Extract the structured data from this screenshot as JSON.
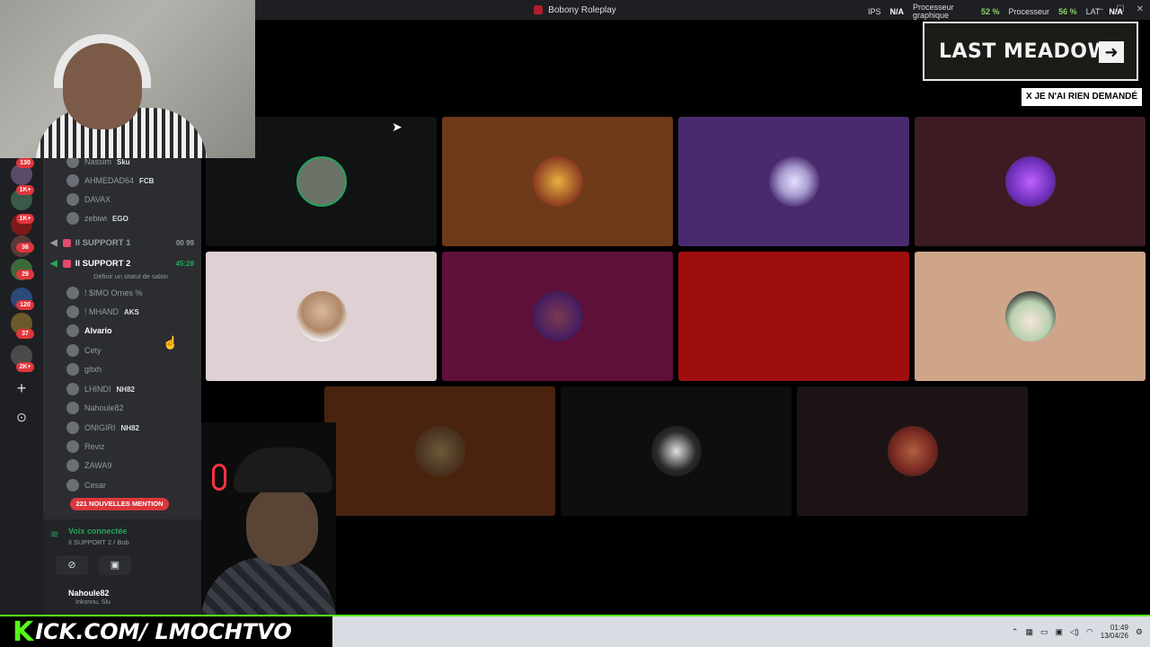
{
  "window": {
    "title": "Bobony Roleplay",
    "controls": [
      "–",
      "☐",
      "✕"
    ]
  },
  "stats": {
    "ips_label": "IPS",
    "ips_value": "N/A",
    "cpu_gpu_label": "Processeur graphique",
    "cpu_gpu_value": "52 %",
    "cpu_label": "Processeur",
    "cpu_value": "56 %",
    "lat_label": "LAT",
    "lat_value": "N/A"
  },
  "rail": {
    "badges": [
      "130",
      "1K+",
      "1K+",
      "36",
      "29",
      "120",
      "37",
      "2K+"
    ],
    "add_icon": "+",
    "explore_icon": "compass-icon"
  },
  "sidebar": {
    "top_members": [
      {
        "name": "Nassim",
        "tag": "Sku"
      },
      {
        "name": "AHMEDAD64",
        "tag": "FCB"
      },
      {
        "name": "DAVAX",
        "tag": ""
      },
      {
        "name": "zebiwi",
        "tag": "EGO"
      }
    ],
    "channels": [
      {
        "name": "Il SUPPORT 1",
        "meta": "00  99"
      },
      {
        "name": "Il SUPPORT 2",
        "meta": "45:28",
        "status": "Définir un statut de salon"
      }
    ],
    "members": [
      {
        "name": "! $IMO Ornes %",
        "tag": ""
      },
      {
        "name": "! MHAND",
        "tag": "AKS"
      },
      {
        "name": "Alvario",
        "tag": ""
      },
      {
        "name": "Cety",
        "tag": ""
      },
      {
        "name": "gltxh",
        "tag": ""
      },
      {
        "name": "LHINDI",
        "tag": "NH82"
      },
      {
        "name": "Nahoule82",
        "tag": ""
      },
      {
        "name": "ONIGIRI",
        "tag": "NH82"
      },
      {
        "name": "Reviz",
        "tag": ""
      },
      {
        "name": "ZAWA9",
        "tag": ""
      },
      {
        "name": "Cesar",
        "tag": ""
      }
    ],
    "mentions": "221 NOUVELLES MENTION",
    "voice": {
      "status": "Voix connectée",
      "channel": "Il SUPPORT 2 / Bob",
      "user": "Nahoule82",
      "sub": "Inkonnu, Slu"
    }
  },
  "tiles": [
    {
      "color": "#111214",
      "avatar": "#6b7268"
    },
    {
      "color": "#6e3a1a",
      "avatar": "#8a3a20"
    },
    {
      "color": "#4a2a6e",
      "avatar": "#a89cd0"
    },
    {
      "color": "#3d1b22",
      "avatar": "#6b2fb8"
    },
    {
      "color": "#ded0d3",
      "avatar": "#c9b09a"
    },
    {
      "color": "#5e0f3a",
      "avatar": "#4a2060"
    },
    {
      "color": "#9e0e0e",
      "avatar": "#9e0e0e"
    },
    {
      "color": "#cfa58a",
      "avatar": "#d8c3a8"
    },
    {
      "color": "#4a230f",
      "avatar": "#5a3a24"
    },
    {
      "color": "#0e0e0e",
      "avatar": "#2a2a2a"
    },
    {
      "color": "#1c1414",
      "avatar": "#7a2a22"
    }
  ],
  "overlays": {
    "logo": "LAST MEADOW",
    "logo_arrow": "➜",
    "subtitle": "X JE N'AI RIEN DEMANDÉ"
  },
  "banner": {
    "k": "K",
    "text": "KICK.COM/LMOCHTVO",
    "display_text": "ICK.COM/ LMOCHTVO"
  },
  "taskbar": {
    "time": "01:49",
    "date": "13/04/26"
  }
}
